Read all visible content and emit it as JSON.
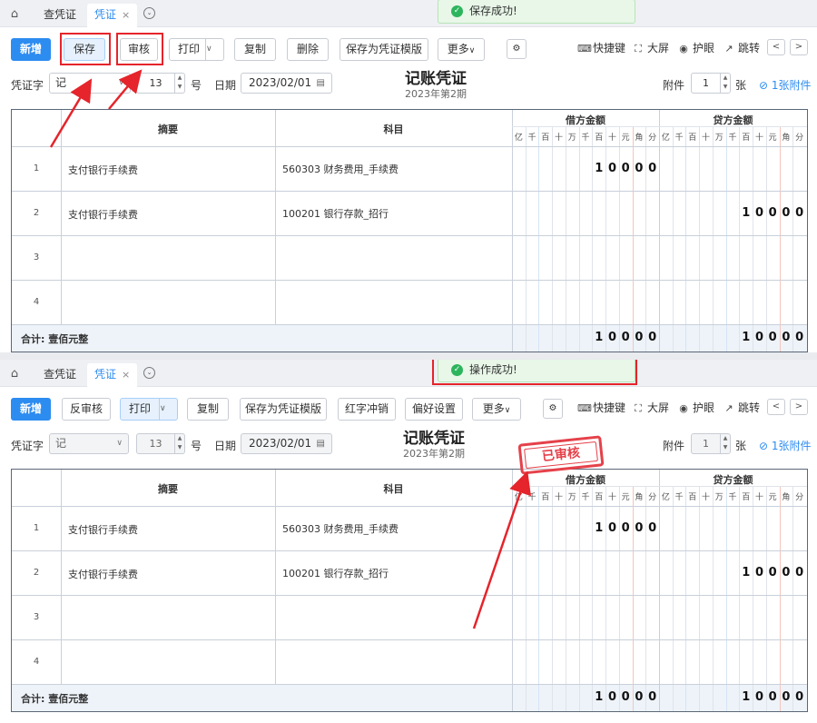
{
  "tabs": {
    "home_icon": "home-icon",
    "query": "查凭证",
    "voucher": "凭证",
    "close": "×",
    "more_icon": "chevron-down-circle-icon"
  },
  "toolbar_top": {
    "new": "新增",
    "save": "保存",
    "review": "审核",
    "print": "打印",
    "copy": "复制",
    "delete": "删除",
    "save_tpl": "保存为凭证模版",
    "more": "更多"
  },
  "toolbar_bottom": {
    "new": "新增",
    "unreview": "反审核",
    "print": "打印",
    "copy": "复制",
    "save_tpl": "保存为凭证模版",
    "red_reverse": "红字冲销",
    "prefs": "偏好设置",
    "more": "更多"
  },
  "tools": {
    "shortcut": "快捷键",
    "fullscreen": "大屏",
    "eye": "护眼",
    "jump": "跳转"
  },
  "form": {
    "word_label": "凭证字",
    "word_value": "记",
    "number": "13",
    "number_suffix": "号",
    "date_label": "日期",
    "date_value": "2023/02/01",
    "attach_label": "附件",
    "attach_count": "1",
    "attach_unit": "张",
    "attach_link": "1张附件"
  },
  "voucher": {
    "title": "记账凭证",
    "period": "2023年第2期"
  },
  "toast_top": "保存成功!",
  "toast_bottom": "操作成功!",
  "stamp": "已审核",
  "table": {
    "col_summary": "摘要",
    "col_account": "科目",
    "col_debit": "借方金额",
    "col_credit": "贷方金额",
    "digits": [
      "亿",
      "千",
      "百",
      "十",
      "万",
      "千",
      "百",
      "十",
      "元",
      "角",
      "分"
    ],
    "rows": [
      {
        "no": "1",
        "summary": "支付银行手续费",
        "account": "560303 财务费用_手续费",
        "debit": [
          "",
          "",
          "",
          "",
          "",
          "",
          "1",
          "0",
          "0",
          "0",
          "0"
        ],
        "credit": [
          "",
          "",
          "",
          "",
          "",
          "",
          "",
          "",
          "",
          "",
          ""
        ]
      },
      {
        "no": "2",
        "summary": "支付银行手续费",
        "account": "100201 银行存款_招行",
        "debit": [
          "",
          "",
          "",
          "",
          "",
          "",
          "",
          "",
          "",
          "",
          ""
        ],
        "credit": [
          "",
          "",
          "",
          "",
          "",
          "",
          "1",
          "0",
          "0",
          "0",
          "0"
        ]
      },
      {
        "no": "3",
        "summary": "",
        "account": "",
        "debit": [
          "",
          "",
          "",
          "",
          "",
          "",
          "",
          "",
          "",
          "",
          ""
        ],
        "credit": [
          "",
          "",
          "",
          "",
          "",
          "",
          "",
          "",
          "",
          "",
          ""
        ]
      },
      {
        "no": "4",
        "summary": "",
        "account": "",
        "debit": [
          "",
          "",
          "",
          "",
          "",
          "",
          "",
          "",
          "",
          "",
          ""
        ],
        "credit": [
          "",
          "",
          "",
          "",
          "",
          "",
          "",
          "",
          "",
          "",
          ""
        ]
      }
    ],
    "total_label": "合计: 壹佰元整",
    "total_debit": [
      "",
      "",
      "",
      "",
      "",
      "",
      "1",
      "0",
      "0",
      "0",
      "0"
    ],
    "total_credit": [
      "",
      "",
      "",
      "",
      "",
      "",
      "1",
      "0",
      "0",
      "0",
      "0"
    ]
  },
  "colors": {
    "primary": "#2d8cf0",
    "annotation_red": "#e5242b",
    "success": "#2db55d"
  }
}
